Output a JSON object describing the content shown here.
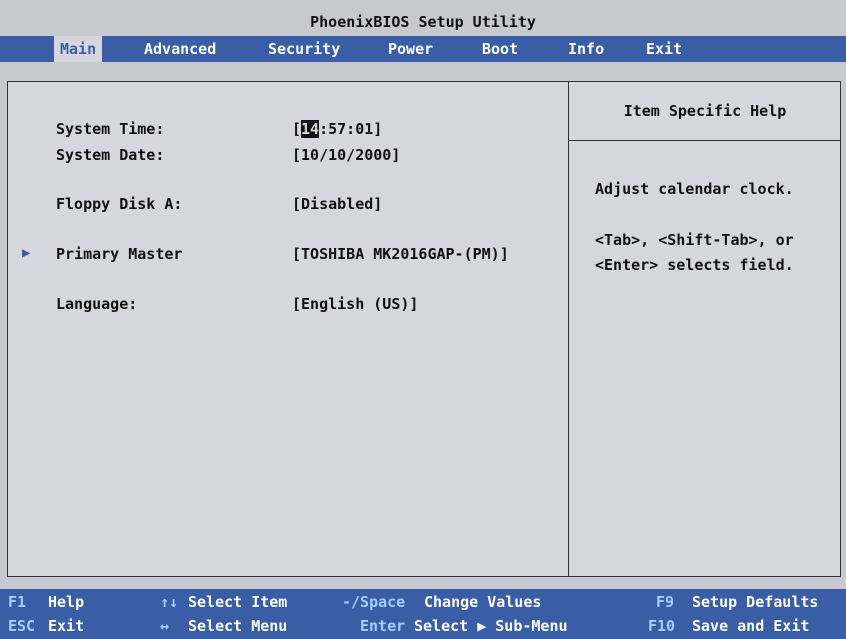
{
  "title": "PhoenixBIOS Setup Utility",
  "menu": {
    "items": [
      "Main",
      "Advanced",
      "Security",
      "Power",
      "Boot",
      "Info",
      "Exit"
    ],
    "active": "Main"
  },
  "fields": {
    "system_time": {
      "label": "System Time:",
      "open": "[",
      "cursor": "14",
      "rest": ":57:01]"
    },
    "system_date": {
      "label": "System Date:",
      "value": "[10/10/2000]"
    },
    "floppy": {
      "label": "Floppy Disk A:",
      "value": "[Disabled]"
    },
    "primary_master": {
      "label": "Primary Master",
      "value": "[TOSHIBA MK2016GAP-(PM)]",
      "arrow": "▶"
    },
    "language": {
      "label": "Language:",
      "value": "[English (US)]"
    }
  },
  "help": {
    "header": "Item Specific Help",
    "line1": "Adjust calendar clock.",
    "line2": "<Tab>, <Shift-Tab>, or",
    "line3": "<Enter> selects field."
  },
  "status": {
    "f1_key": "F1",
    "f1_label": "Help",
    "esc_key": "ESC",
    "esc_label": "Exit",
    "updown_key": "↑↓",
    "updown_label": "Select Item",
    "leftright_key": "↔",
    "leftright_label": "Select Menu",
    "space_key": "-/Space",
    "space_label": "Change Values",
    "enter_key": "Enter",
    "enter_label": "Select ▶ Sub-Menu",
    "f9_key": "F9",
    "f9_label": "Setup Defaults",
    "f10_key": "F10",
    "f10_label": "Save and Exit"
  },
  "colors": {
    "menu_bg": "#3a5ea6",
    "panel_bg": "#d6d6de",
    "key_color": "#9fd0ff"
  }
}
